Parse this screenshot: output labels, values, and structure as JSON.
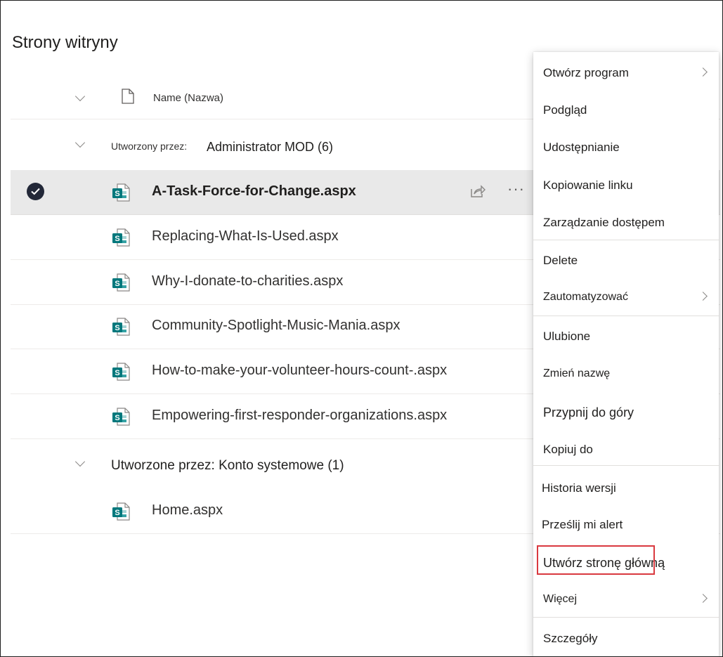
{
  "page": {
    "title": "Strony witryny"
  },
  "columns": {
    "name_header": "Name (Nazwa)"
  },
  "groups": [
    {
      "prefix": "Utworzony przez:",
      "value": "Administrator MOD (6)",
      "files": [
        {
          "name": "A-Task-Force-for-Change.aspx",
          "selected": true
        },
        {
          "name": "Replacing-What-Is-Used.aspx",
          "selected": false
        },
        {
          "name": "Why-I-donate-to-charities.aspx",
          "selected": false
        },
        {
          "name": "Community-Spotlight-Music-Mania.aspx",
          "selected": false
        },
        {
          "name": "How-to-make-your-volunteer-hours-count-.aspx",
          "selected": false
        },
        {
          "name": "Empowering-first-responder-organizations.aspx",
          "selected": false
        }
      ]
    },
    {
      "label": "Utworzone przez: Konto systemowe (1)",
      "files": [
        {
          "name": "Home.aspx",
          "selected": false
        }
      ]
    }
  ],
  "row_actions": {
    "share_icon": "share-icon",
    "more_icon": "more-icon",
    "more_text": "···"
  },
  "context_menu": {
    "items": [
      {
        "label": "Otwórz program",
        "submenu": true
      },
      {
        "label": "Podgląd"
      },
      {
        "label": "Udostępnianie"
      },
      {
        "label": "Kopiowanie linku"
      },
      {
        "label": "Zarządzanie dostępem"
      },
      {
        "label": "Delete"
      },
      {
        "label": "Zautomatyzować",
        "submenu": true
      },
      {
        "label": "Ulubione"
      },
      {
        "label": "Zmień nazwę"
      },
      {
        "label": "Przypnij do góry"
      },
      {
        "label": "Kopiuj do"
      },
      {
        "label": "Historia wersji"
      },
      {
        "label": "Prześlij mi alert"
      },
      {
        "label": "Utwórz stronę główną",
        "highlighted": true
      },
      {
        "label": "Więcej",
        "submenu": true
      },
      {
        "label": "Szczegóły"
      }
    ]
  },
  "colors": {
    "highlight_border": "#d9393f",
    "selected_row": "#e9e9e9",
    "check_fill": "#222838",
    "sharepoint_teal": "#03787c"
  }
}
